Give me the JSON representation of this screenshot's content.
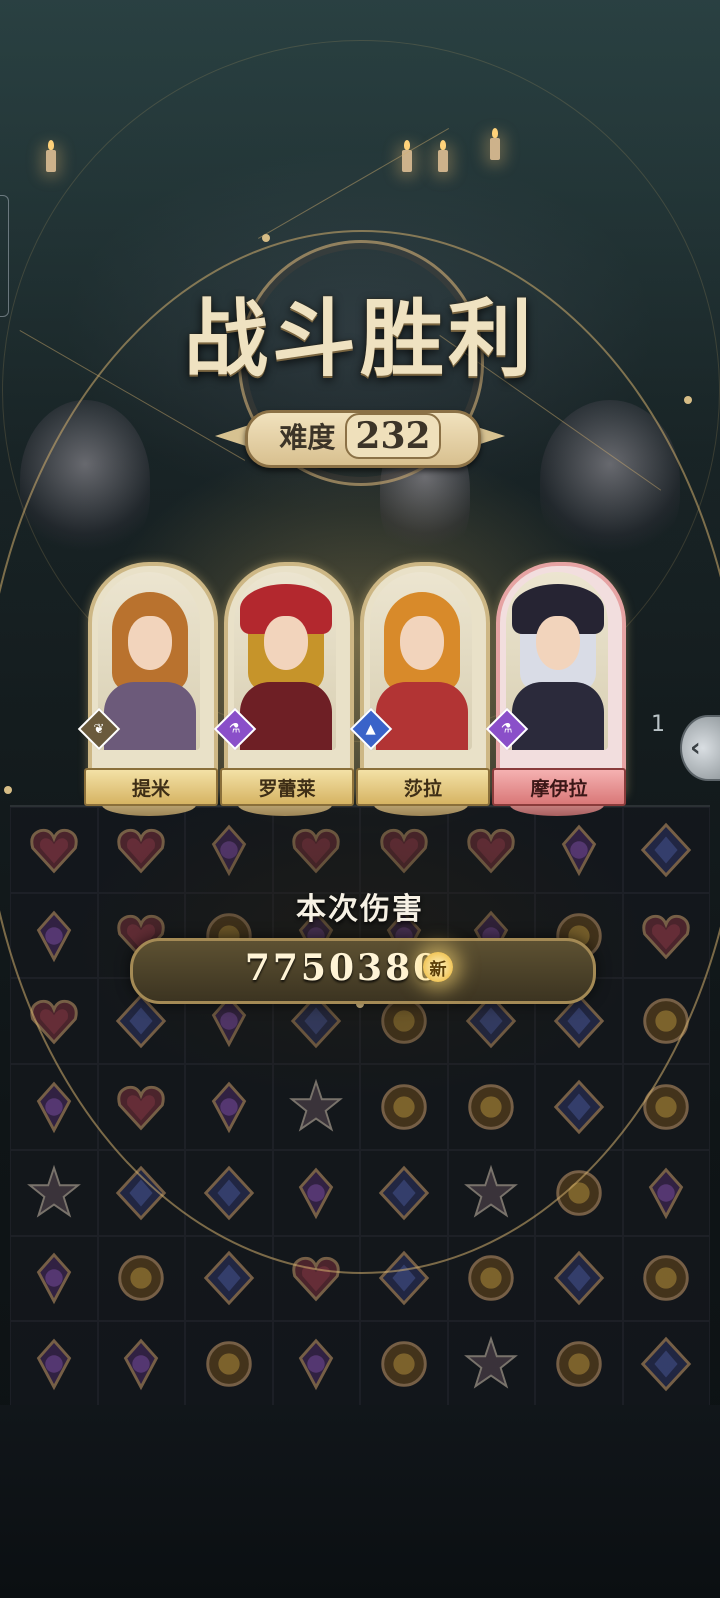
{
  "title": "战斗胜利",
  "difficulty": {
    "label": "难度",
    "value": "232"
  },
  "heroes": [
    {
      "name": "提米",
      "class_icon": "leaf-icon",
      "badge_color": "#6a5a3c",
      "hair": "#b9722e",
      "body": "#6c5a7a",
      "highlight": false
    },
    {
      "name": "罗蕾莱",
      "class_icon": "potion-icon",
      "badge_color": "#8a4fc9",
      "hair": "#c6942a",
      "body": "#6e1f25",
      "highlight": false
    },
    {
      "name": "莎拉",
      "class_icon": "top-hat-icon",
      "badge_color": "#3a63c9",
      "hair": "#d88a2a",
      "body": "#b23434",
      "highlight": false
    },
    {
      "name": "摩伊拉",
      "class_icon": "potion-icon",
      "badge_color": "#8a4fc9",
      "hair": "#d9dce6",
      "body": "#2b2a3b",
      "highlight": true
    }
  ],
  "damage": {
    "label": "本次伤害",
    "value": "7750380",
    "new_badge": "新"
  },
  "side": {
    "counter": "1"
  },
  "colors": {
    "gold": "#d7bd86",
    "accent_red": "#d97878"
  },
  "board": [
    [
      "heart",
      "heart",
      "potion",
      "heart",
      "heart",
      "heart",
      "potion",
      "diamond"
    ],
    [
      "potion",
      "heart",
      "sun",
      "potion",
      "potion",
      "potion",
      "sun",
      "heart"
    ],
    [
      "heart",
      "diamond",
      "potion",
      "diamond",
      "sun",
      "diamond",
      "diamond",
      "sun"
    ],
    [
      "potion",
      "heart",
      "potion",
      "star",
      "sun",
      "sun",
      "diamond",
      "sun"
    ],
    [
      "star",
      "diamond",
      "diamond",
      "potion",
      "diamond",
      "star",
      "sun",
      "potion"
    ],
    [
      "potion",
      "sun",
      "diamond",
      "heart",
      "diamond",
      "sun",
      "diamond",
      "sun"
    ],
    [
      "potion",
      "potion",
      "sun",
      "potion",
      "sun",
      "star",
      "sun",
      "diamond"
    ]
  ]
}
